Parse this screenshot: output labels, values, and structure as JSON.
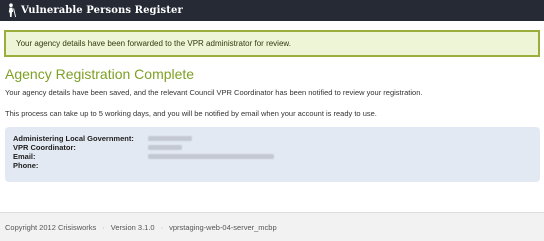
{
  "header": {
    "brand": "Vulnerable Persons Register",
    "logo_icon": "person-with-cane-icon"
  },
  "alert": {
    "message": "Your agency details have been forwarded to the VPR administrator for review."
  },
  "main": {
    "title": "Agency Registration Complete",
    "paragraph1": "Your agency details have been saved, and the relevant Council VPR Coordinator has been notified to review your registration.",
    "paragraph2": "This process can take up to 5 working days, and you will be notified by email when your account is ready to use."
  },
  "details": {
    "rows": [
      {
        "label": "Administering Local Government:"
      },
      {
        "label": "VPR Coordinator:"
      },
      {
        "label": "Email:"
      },
      {
        "label": "Phone:"
      }
    ]
  },
  "footer": {
    "copyright": "Copyright 2012 Crisisworks",
    "separator": "·",
    "version": "Version 3.1.0",
    "server": "vprstaging-web-04-server_mcbp"
  },
  "colors": {
    "topbar": "#252a35",
    "alert_bg": "#eef5d6",
    "alert_border": "#9bad3a",
    "title_green": "#7ea024",
    "details_bg": "#e3e9f3",
    "footer_bg": "#f2f2f2"
  }
}
